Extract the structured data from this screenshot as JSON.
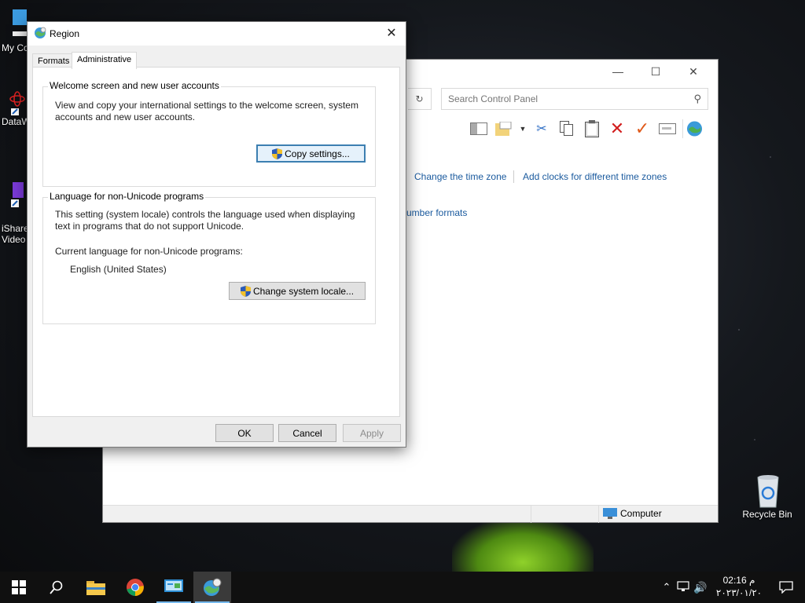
{
  "desktop": {
    "icons": [
      {
        "label": "My Co"
      },
      {
        "label": "DataW"
      },
      {
        "label": "iShare\nVideo"
      },
      {
        "label": "Recycle Bin"
      }
    ]
  },
  "control_panel": {
    "search_placeholder": "Search Control Panel",
    "links": {
      "change_time_zone": "Change the time zone",
      "add_clocks": "Add clocks for different time zones",
      "number_formats": "umber formats"
    },
    "status": {
      "computer": "Computer"
    },
    "toolbar_icons": [
      "pane-icon",
      "folder-icon",
      "dropdown-icon",
      "cut-icon",
      "copy-icon",
      "paste-icon",
      "delete-icon",
      "check-icon",
      "rename-icon",
      "globe-icon"
    ]
  },
  "dialog": {
    "title": "Region",
    "tabs": [
      {
        "label": "Formats",
        "active": false
      },
      {
        "label": "Administrative",
        "active": true
      }
    ],
    "welcome_group": {
      "legend": "Welcome screen and new user accounts",
      "description": "View and copy your international settings to the welcome screen, system accounts and new user accounts.",
      "button": "Copy settings..."
    },
    "locale_group": {
      "legend": "Language for non-Unicode programs",
      "description": "This setting (system locale) controls the language used when displaying text in programs that do not support Unicode.",
      "current_label": "Current language for non-Unicode programs:",
      "current_value": "English (United States)",
      "button": "Change system locale..."
    },
    "buttons": {
      "ok": "OK",
      "cancel": "Cancel",
      "apply": "Apply"
    }
  },
  "taskbar": {
    "clock": {
      "time": "02:16 م",
      "date": "٢٠٢٣/٠١/٢٠"
    }
  },
  "colors": {
    "link": "#1a5a9e",
    "default_button_border": "#3c7fb1",
    "taskbar": "#101010"
  }
}
